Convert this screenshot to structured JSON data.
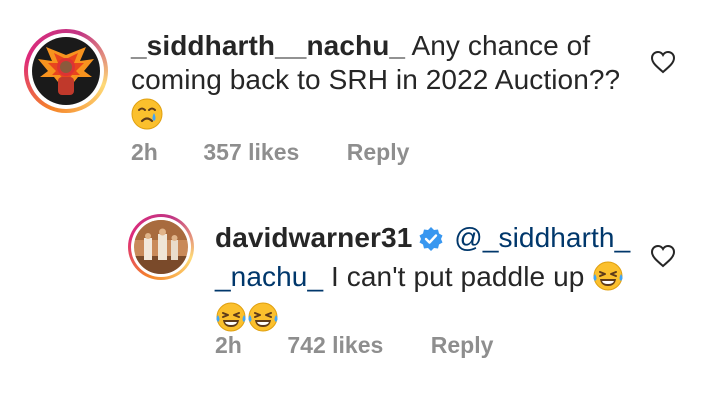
{
  "comments": [
    {
      "username": "_siddharth__nachu_",
      "text": "Any chance of coming back to SRH in 2022 Auction??",
      "text_line1": "Any chance of",
      "text_line2": "coming back to SRH in 2022 Auction??",
      "emoji": "crying-face-emoji",
      "time": "2h",
      "likes": "357 likes",
      "reply_label": "Reply",
      "avatar_icon": "srh-logo-avatar-icon"
    },
    {
      "username": "davidwarner31",
      "verified": true,
      "mention": "@_siddharth_ _nachu_",
      "mention_line1": "@_siddharth_",
      "mention_line2": "_nachu_",
      "text": "I can't put paddle up",
      "emoji": "face-with-tears-of-joy-emoji",
      "time": "2h",
      "likes": "742 likes",
      "reply_label": "Reply",
      "avatar_icon": "photo-avatar-icon"
    }
  ],
  "colors": {
    "text": "#262626",
    "meta": "#8e8e8e",
    "mention": "#00376b",
    "verified": "#3897f0"
  },
  "icons": [
    "heart-outline-icon",
    "verified-badge-icon"
  ]
}
